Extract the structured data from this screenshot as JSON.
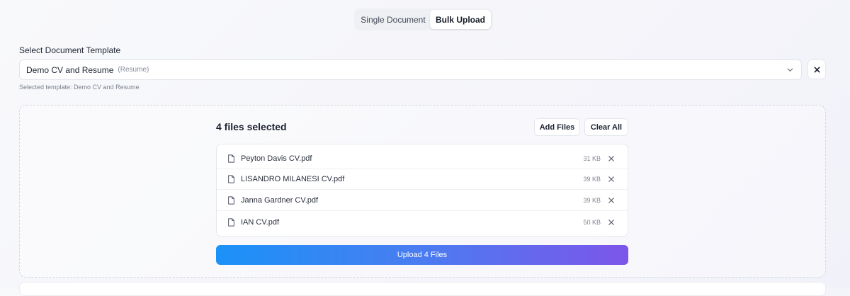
{
  "tabs": [
    {
      "label": "Single Document",
      "active": false
    },
    {
      "label": "Bulk Upload",
      "active": true
    }
  ],
  "template": {
    "label": "Select Document Template",
    "selected_value": "Demo CV and Resume",
    "selected_type": "(Resume)",
    "helper": "Selected template: Demo CV and Resume"
  },
  "upload": {
    "count_label": "4 files selected",
    "add_label": "Add Files",
    "clear_label": "Clear All",
    "files": [
      {
        "name": "Peyton Davis CV.pdf",
        "size": "31 KB"
      },
      {
        "name": "LISANDRO MILANESI CV.pdf",
        "size": "39 KB"
      },
      {
        "name": "Janna Gardner CV.pdf",
        "size": "39 KB"
      },
      {
        "name": "IAN CV.pdf",
        "size": "50 KB"
      }
    ],
    "submit_label": "Upload 4 Files"
  },
  "icons": {
    "file": "file-icon",
    "remove": "close-icon",
    "dropdown": "chevron-down-icon"
  },
  "colors": {
    "gradient_start": "#1b92f8",
    "gradient_end": "#7d55ea"
  }
}
